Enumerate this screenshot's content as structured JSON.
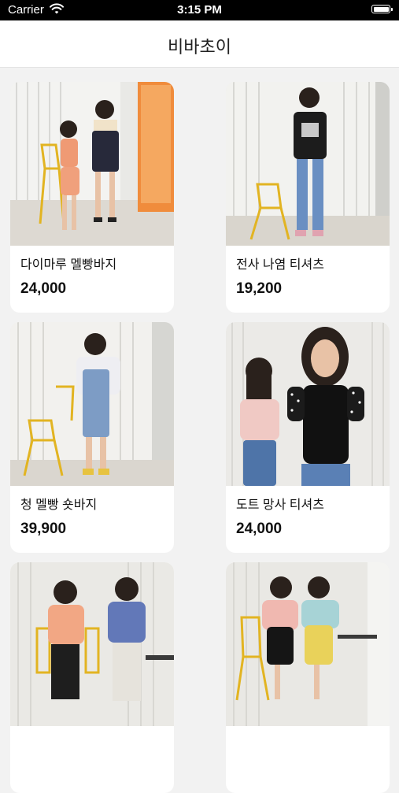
{
  "status_bar": {
    "carrier": "Carrier",
    "time": "3:15 PM",
    "wifi_icon": "wifi-icon",
    "battery_icon": "battery-icon"
  },
  "header": {
    "title": "비바초이"
  },
  "products": [
    {
      "name": "다이마루 멜빵바지",
      "price": "24,000"
    },
    {
      "name": "전사 나염 티셔츠",
      "price": "19,200"
    },
    {
      "name": "청 멜빵 숏바지",
      "price": "39,900"
    },
    {
      "name": "도트 망사 티셔츠",
      "price": "24,000"
    },
    {
      "name": "",
      "price": ""
    },
    {
      "name": "",
      "price": ""
    }
  ],
  "colors": {
    "background": "#f2f2f2",
    "card": "#ffffff",
    "text": "#111111",
    "status_bar": "#000000"
  }
}
